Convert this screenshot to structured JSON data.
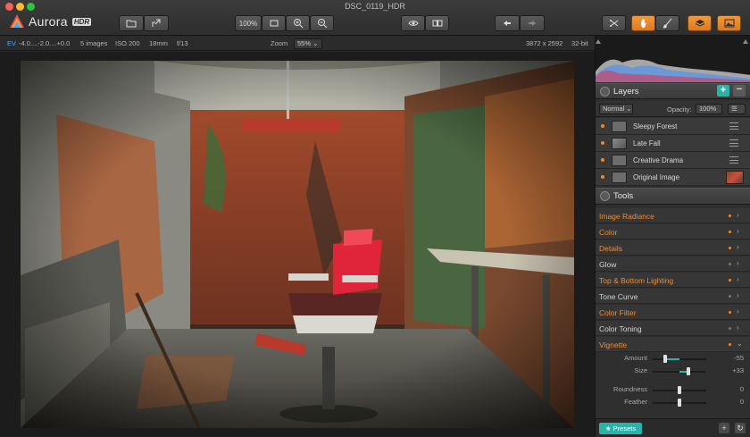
{
  "window": {
    "title": "DSC_0119_HDR"
  },
  "app": {
    "name": "Aurora",
    "badge": "HDR"
  },
  "toolbar": {
    "zoom_fit_label": "100%",
    "buttons": [
      "open-icon",
      "share-icon",
      "fit-icon",
      "zoom-in-icon",
      "zoom-out-icon",
      "preview-eye-icon",
      "compare-icon",
      "undo-icon",
      "redo-icon",
      "crop-icon",
      "hand-icon",
      "brush-icon",
      "layers-icon",
      "mask-icon"
    ],
    "accent": "#e8872e"
  },
  "infobar": {
    "ev_label": "EV",
    "ev_values": "-4.0....-2.0....+0.0",
    "images": "5 images",
    "iso": "ISO 200",
    "focal": "18mm",
    "aperture": "f/13",
    "zoom_label": "Zoom",
    "zoom_value": "55%",
    "dimensions": "3872 x 2592",
    "bit_depth": "32-bit"
  },
  "layers": {
    "title": "Layers",
    "blend_mode": "Normal",
    "opacity_label": "Opacity:",
    "opacity_value": "100%",
    "items": [
      {
        "name": "Sleepy Forest"
      },
      {
        "name": "Late Fall"
      },
      {
        "name": "Creative Drama"
      },
      {
        "name": "Original Image"
      }
    ]
  },
  "tools": {
    "title": "Tools",
    "items": [
      {
        "name": "Image Radiance",
        "active": true
      },
      {
        "name": "Color",
        "active": true
      },
      {
        "name": "Details",
        "active": true
      },
      {
        "name": "Glow",
        "active": false
      },
      {
        "name": "Top & Bottom Lighting",
        "active": true
      },
      {
        "name": "Tone Curve",
        "active": false
      },
      {
        "name": "Color Filter",
        "active": true
      },
      {
        "name": "Color Toning",
        "active": false
      },
      {
        "name": "Vignette",
        "active": true
      }
    ],
    "vignette_sliders": [
      {
        "label": "Amount",
        "value": "-55",
        "level": -0.55
      },
      {
        "label": "Size",
        "value": "+33",
        "level": 0.33
      },
      {
        "label": "Roundness",
        "value": "0",
        "level": 0
      },
      {
        "label": "Feather",
        "value": "0",
        "level": 0
      }
    ]
  },
  "bottom": {
    "presets_label": "★ Presets",
    "accent": "#2ab3a8"
  }
}
